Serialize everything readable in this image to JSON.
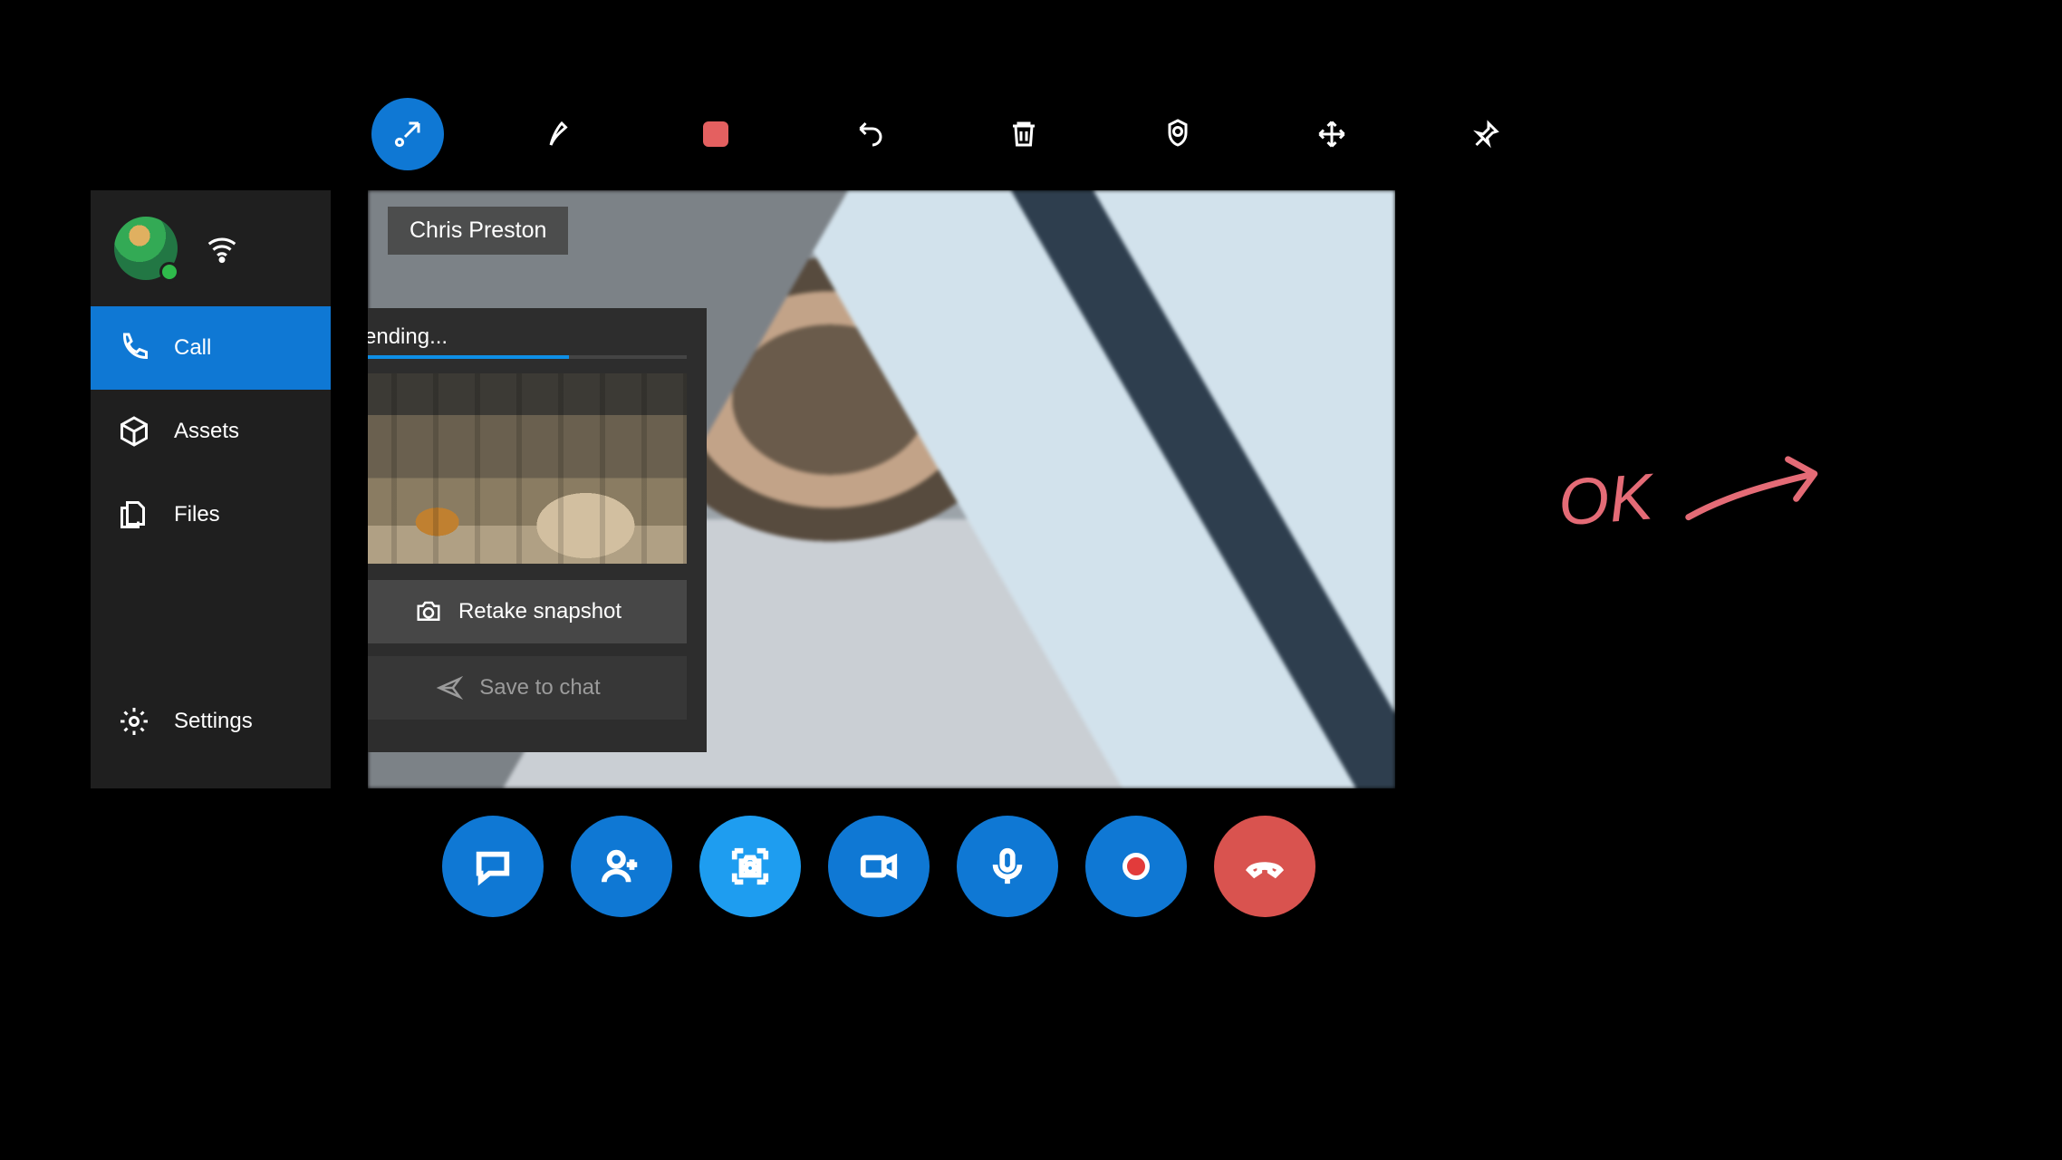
{
  "toolbar": {
    "collapse_icon": "collapse-icon",
    "pen_icon": "pen-icon",
    "stop_icon": "stop-icon",
    "undo_icon": "undo-icon",
    "delete_icon": "trash-icon",
    "lens_icon": "lens-icon",
    "move_icon": "move-icon",
    "pin_icon": "pin-icon"
  },
  "sidebar": {
    "wifi_icon": "wifi-icon",
    "items": [
      {
        "icon": "phone-icon",
        "label": "Call",
        "selected": true
      },
      {
        "icon": "package-icon",
        "label": "Assets",
        "selected": false
      },
      {
        "icon": "files-icon",
        "label": "Files",
        "selected": false
      }
    ],
    "settings": {
      "icon": "gear-icon",
      "label": "Settings"
    }
  },
  "call": {
    "remote_name": "Chris Preston"
  },
  "snapshot_panel": {
    "status_label": "Sending...",
    "progress_percent": 65,
    "retake_label": "Retake snapshot",
    "save_label": "Save to chat",
    "save_enabled": false
  },
  "dock": {
    "chat_icon": "chat-icon",
    "add_person_icon": "add-person-icon",
    "snapshot_icon": "snapshot-icon",
    "video_icon": "video-icon",
    "mic_icon": "mic-icon",
    "record_icon": "record-icon",
    "hangup_icon": "hangup-icon"
  },
  "annotation": {
    "text": "OK",
    "arrow_icon": "arrow-right-icon",
    "color": "#e46b76"
  }
}
